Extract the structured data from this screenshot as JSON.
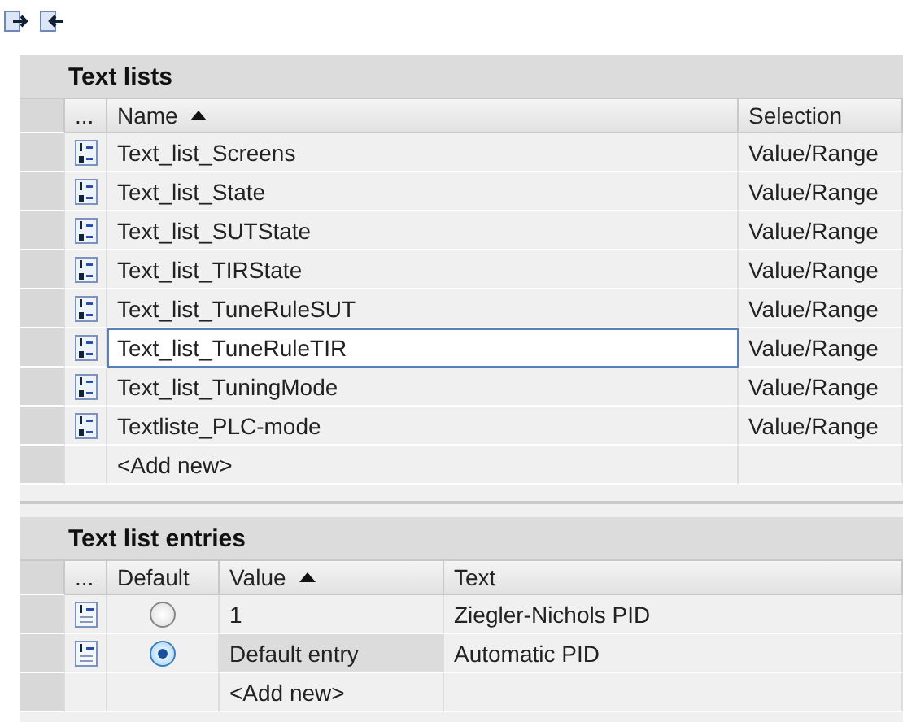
{
  "text_lists": {
    "title": "Text lists",
    "columns": [
      {
        "label": "...",
        "sorted": false
      },
      {
        "label": "Name",
        "sorted": true
      },
      {
        "label": "Selection",
        "sorted": false
      }
    ],
    "rows": [
      {
        "name": "Text_list_Screens",
        "selection": "Value/Range",
        "selected": false
      },
      {
        "name": "Text_list_State",
        "selection": "Value/Range",
        "selected": false
      },
      {
        "name": "Text_list_SUTState",
        "selection": "Value/Range",
        "selected": false
      },
      {
        "name": "Text_list_TIRState",
        "selection": "Value/Range",
        "selected": false
      },
      {
        "name": "Text_list_TuneRuleSUT",
        "selection": "Value/Range",
        "selected": false
      },
      {
        "name": "Text_list_TuneRuleTIR",
        "selection": "Value/Range",
        "selected": true
      },
      {
        "name": "Text_list_TuningMode",
        "selection": "Value/Range",
        "selected": false
      },
      {
        "name": "Textliste_PLC-mode",
        "selection": "Value/Range",
        "selected": false
      }
    ],
    "add_new": "<Add new>"
  },
  "entries": {
    "title": "Text list entries",
    "columns": [
      {
        "label": "...",
        "sorted": false
      },
      {
        "label": "Default",
        "sorted": false
      },
      {
        "label": "Value",
        "sorted": true
      },
      {
        "label": "Text",
        "sorted": false
      }
    ],
    "rows": [
      {
        "default": false,
        "value": "1",
        "text": "Ziegler-Nichols PID",
        "selected": false
      },
      {
        "default": true,
        "value": "Default entry",
        "text": "Automatic PID",
        "selected": true
      }
    ],
    "add_new": "<Add new>"
  }
}
